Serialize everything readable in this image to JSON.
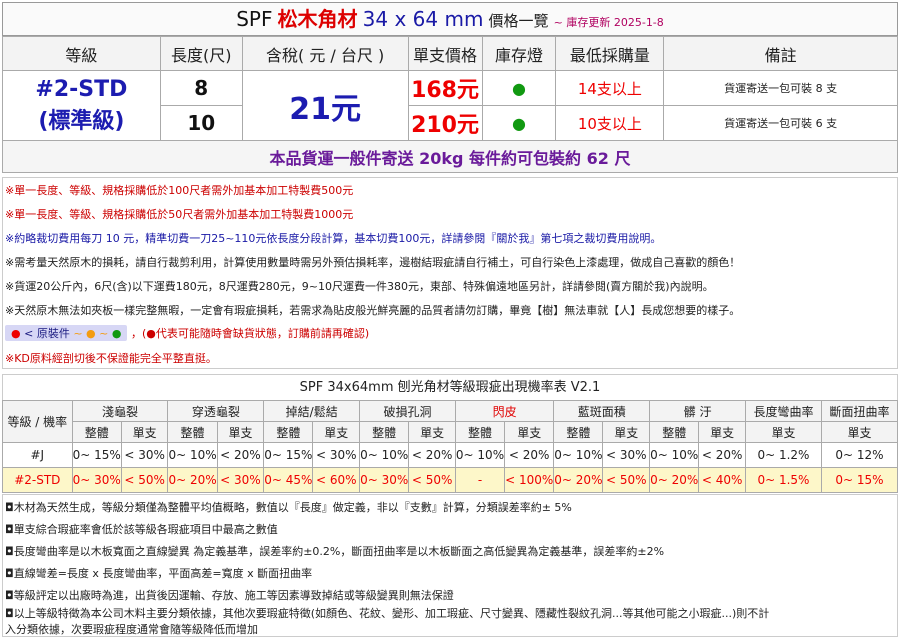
{
  "header": {
    "brand": "SPF",
    "product": "松木角材",
    "size": "34 x 64 mm",
    "price_list": "價格一覽",
    "stock_update": "~ 庫存更新 2025-1-8"
  },
  "table_headers": [
    "等級",
    "長度(尺)",
    "含稅( 元 / 台尺 )",
    "單支價格",
    "庫存燈",
    "最低採購量",
    "備註"
  ],
  "grade": {
    "code": "#2-STD",
    "name": "(標準級)"
  },
  "tax_price": "21元",
  "rows": [
    {
      "length": "8",
      "unit_price": "168元",
      "stock_icon": "●",
      "min_qty": "14支以上",
      "remark": "貨運寄送一包可裝 8 支"
    },
    {
      "length": "10",
      "unit_price": "210元",
      "stock_icon": "●",
      "min_qty": "10支以上",
      "remark": "貨運寄送一包可裝 6 支"
    }
  ],
  "shipping_note": "本品貨運一般件寄送 20kg 每件約可包裝約 62 尺",
  "notes": {
    "n1": "※單一長度、等級、規格採購低於100尺者需外加基本加工特製費500元",
    "n2": "※單一長度、等級、規格採購低於50尺者需外加基本加工特製費1000元",
    "n3": "※約略裁切費用每刀 10 元，精準切費一刀25~110元依長度分段計算，基本切費100元，詳請參閱『關於我』第七項之裁切費用說明。",
    "n4": "※需考量天然原木的損耗，請自行裁剪利用，計算使用數量時需另外預估損耗率，邊樹結瑕疵請自行補土，可自行染色上漆處理，做成自己喜歡的顏色！",
    "n5": "※貨運20公斤內，6尺(含)以下運費180元，8尺運費280元，9~10尺運費一件380元，東部、特殊偏遠地區另計，詳請參閱(賣方關於我)內說明。",
    "n6": "※天然原木無法如夾板一樣完整無暇，一定會有瑕疵損耗，若需求為貼皮般光鮮亮麗的品質者請勿訂購，畢竟【樹】無法車就【人】長成您想要的樣子。",
    "legend_label": "< 原裝件",
    "legend_sep": "~",
    "legend_open": "，(",
    "legend_text": "代表可能隨時會缺貨狀態，訂購前請再確認)",
    "n8": "※KD原料經剖切後不保證能完全平整直挺。"
  },
  "defect": {
    "title": "SPF 34x64mm 刨光角材等級瑕疵出現機率表 V2.1",
    "grade_header": "等級 / 機率",
    "groups": [
      "淺龜裂",
      "穿透龜裂",
      "掉結/鬆結",
      "破損孔洞",
      "閃皮",
      "藍斑面積",
      "髒 汙",
      "長度彎曲率",
      "斷面扭曲率"
    ],
    "sub_whole": "整體",
    "sub_single": "單支",
    "rows": [
      {
        "grade": "#J",
        "values": [
          "0~ 15%",
          "< 30%",
          "0~ 10%",
          "< 20%",
          "0~ 15%",
          "< 30%",
          "0~ 10%",
          "< 20%",
          "0~ 10%",
          "< 20%",
          "0~ 10%",
          "< 30%",
          "0~ 10%",
          "< 20%",
          "0~ 1.2%",
          "0~ 12%"
        ]
      },
      {
        "grade": "#2-STD",
        "values": [
          "0~ 30%",
          "< 50%",
          "0~ 20%",
          "< 30%",
          "0~ 45%",
          "< 60%",
          "0~ 30%",
          "< 50%",
          "-",
          "< 100%",
          "0~ 20%",
          "< 50%",
          "0~ 20%",
          "< 40%",
          "0~ 1.5%",
          "0~ 15%"
        ]
      }
    ]
  },
  "footnotes": [
    "◘木材為天然生成，等級分類僅為整體平均值概略，數值以『長度』做定義，非以『支數』計算，分類誤差率約± 5%",
    "◘單支綜合瑕疵率會低於該等級各瑕疵項目中最高之數值",
    "◘長度彎曲率是以木板寬面之直線變異 為定義基準，誤差率約±0.2%，斷面扭曲率是以木板斷面之高低變異為定義基準，誤差率約±2%",
    "◘直線彎差=長度 x 長度彎曲率，平面高差=寬度 x 斷面扭曲率",
    "◘等級評定以出廠時為進，出貨後因運輸、存放、施工等因素導致掉結或等級變異則無法保證",
    "◘以上等級特徵為本公司木料主要分類依據，其他次要瑕疵特徵(如顏色、花紋、變形、加工瑕疵、尺寸變異、隱藏性裂紋孔洞...等其他可能之小瑕疵...)則不計",
    "入分類依據，次要瑕疵程度通常會隨等級降低而增加"
  ],
  "colors": {
    "accent_red": "#e00000",
    "accent_blue": "#1c1cb0",
    "stock_green": "#119911",
    "std_row_bg": "#fdf7c9"
  }
}
